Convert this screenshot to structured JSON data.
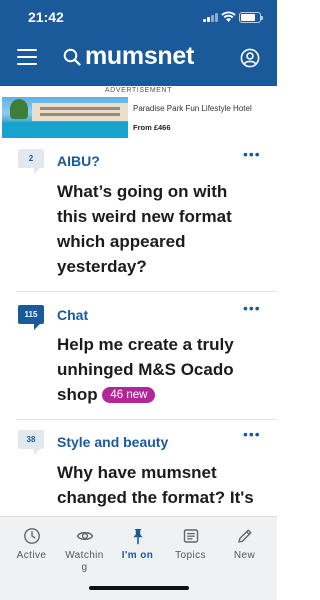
{
  "status": {
    "time": "21:42"
  },
  "header": {
    "logo": "mumsnet"
  },
  "ad": {
    "label": "ADVERTISEMENT",
    "title": "Paradise Park Fun Lifestyle Hotel",
    "price": "From £466"
  },
  "threads": [
    {
      "count": "2",
      "category": "AIBU?",
      "title": "What’s going on with this weird new format which appeared yesterday?",
      "new_label": ""
    },
    {
      "count": "115",
      "category": "Chat",
      "title": "Help me create a truly unhinged M&S Ocado shop",
      "new_label": "46 new"
    },
    {
      "count": "38",
      "category": "Style and beauty",
      "title": "Why have mumsnet changed the format? It's so fully...",
      "new_label": ""
    }
  ],
  "tabs": [
    {
      "label": "Active",
      "icon": "clock-icon"
    },
    {
      "label": "Watchin\ng",
      "icon": "eye-icon"
    },
    {
      "label": "I'm on",
      "icon": "pin-icon"
    },
    {
      "label": "Topics",
      "icon": "list-icon"
    },
    {
      "label": "New",
      "icon": "pencil-icon"
    }
  ],
  "colors": {
    "brand": "#1a5a9a",
    "new_badge": "#b0279b"
  }
}
